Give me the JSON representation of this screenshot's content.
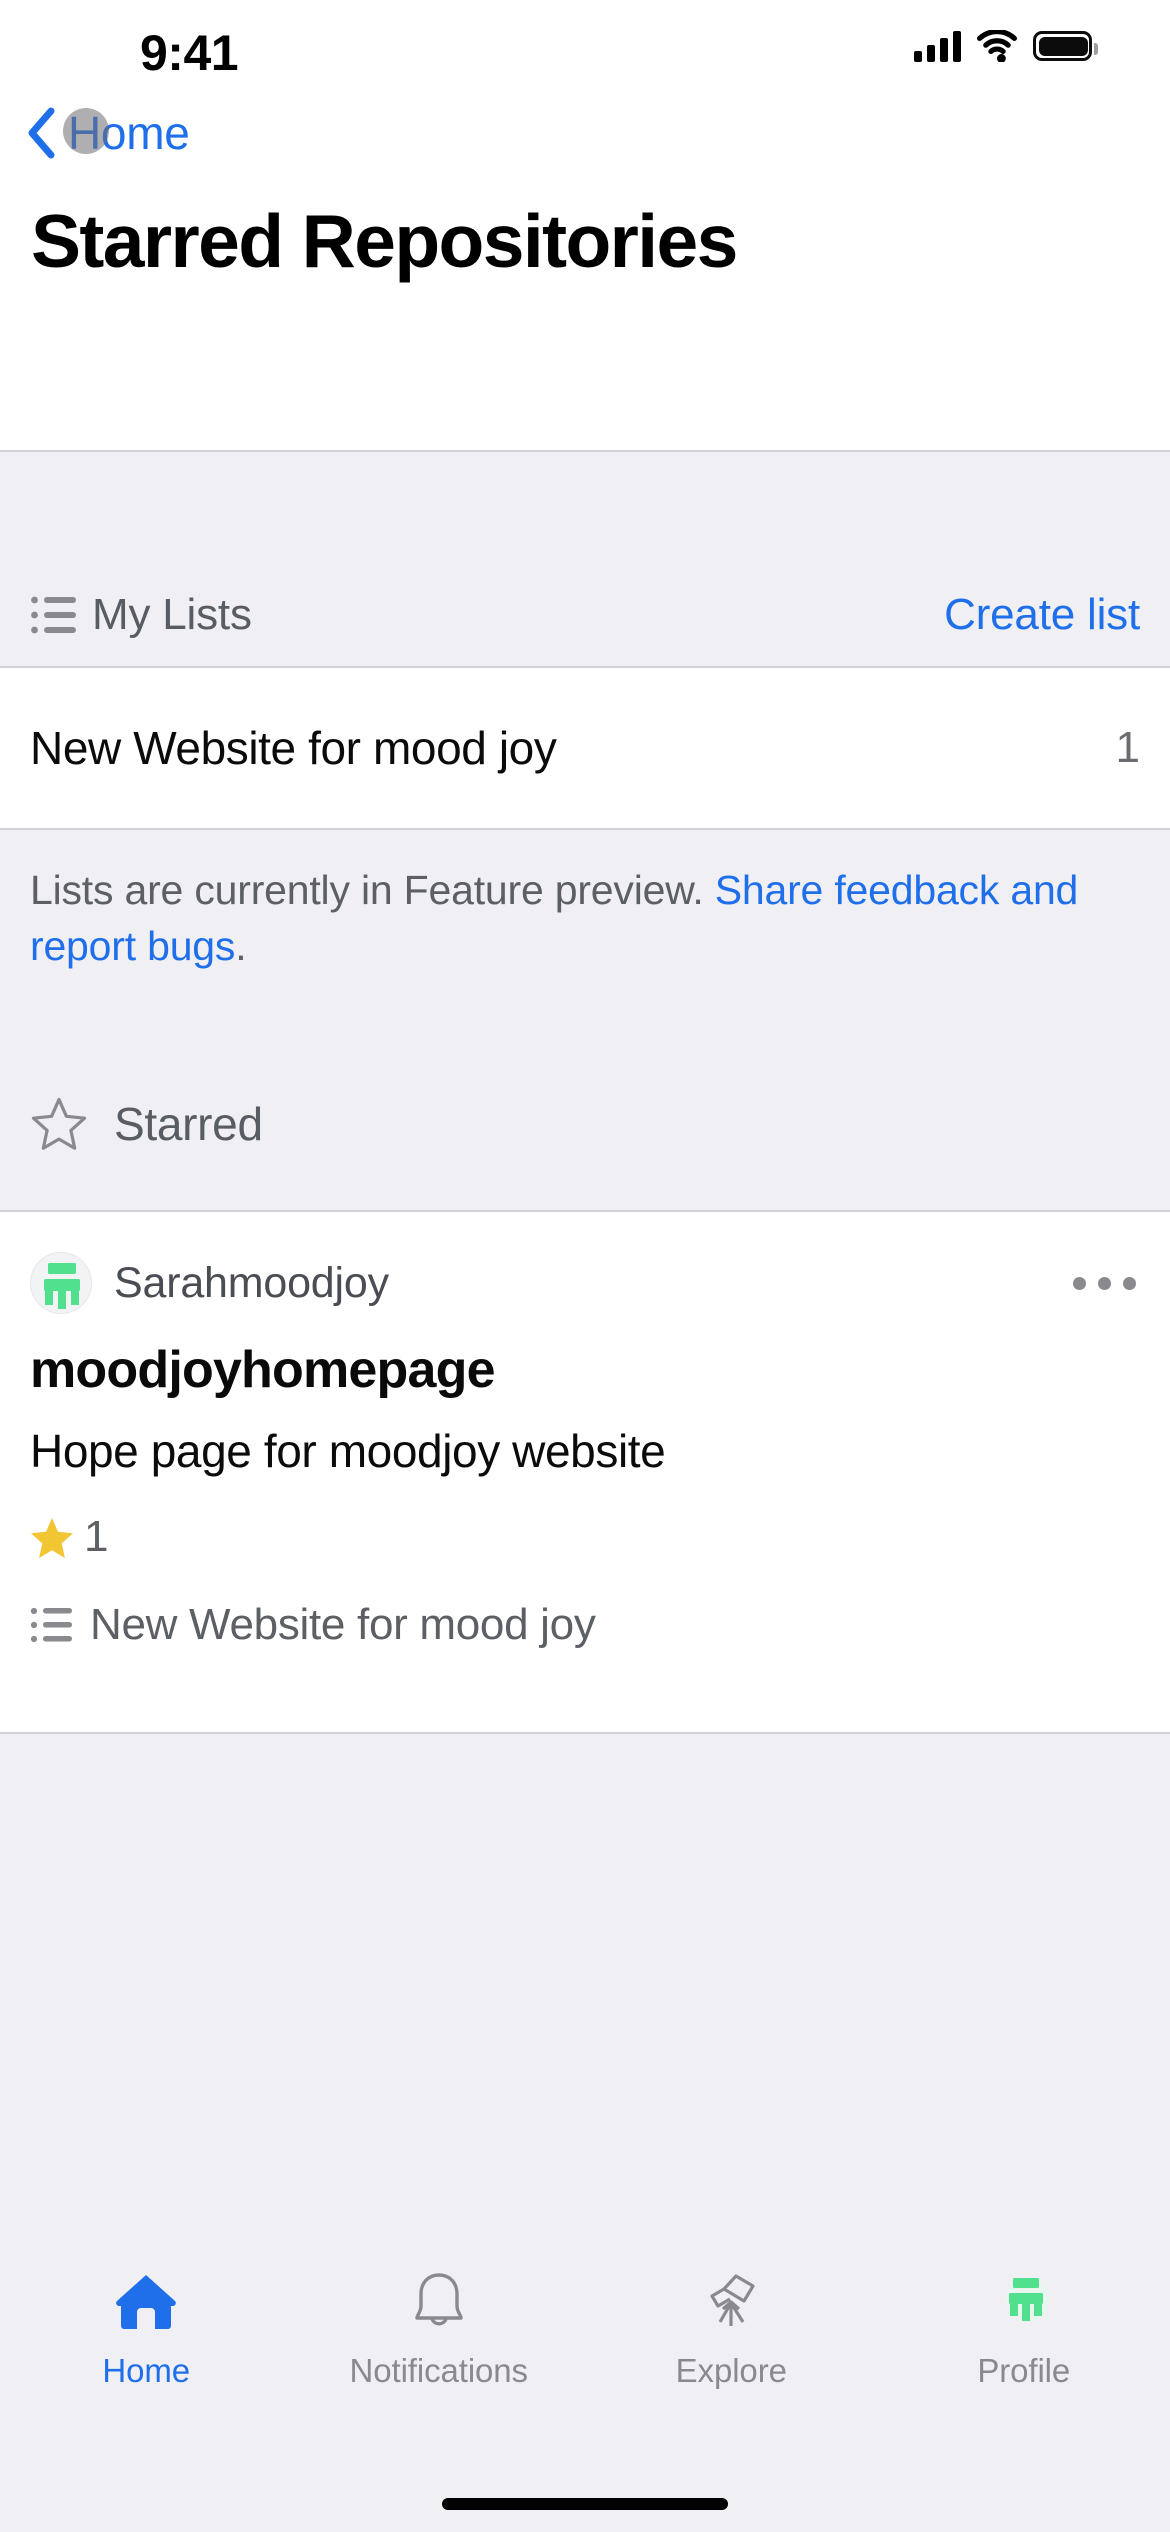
{
  "status_bar": {
    "time": "9:41",
    "signal_icon": "cellular-signal-icon",
    "wifi_icon": "wifi-icon",
    "battery_icon": "battery-full-icon"
  },
  "nav": {
    "back_icon": "chevron-left-icon",
    "back_label": "Home"
  },
  "header": {
    "title": "Starred Repositories"
  },
  "my_lists": {
    "icon": "unordered-list-icon",
    "label": "My Lists",
    "action_label": "Create list",
    "items": [
      {
        "name": "New Website for mood joy",
        "count": "1"
      }
    ]
  },
  "preview_note": {
    "text": "Lists are currently in Feature preview. ",
    "link_text": "Share feedback and report bugs",
    "trailing": "."
  },
  "starred_section": {
    "icon": "star-outline-icon",
    "label": "Starred"
  },
  "repositories": [
    {
      "avatar_icon": "moodjoy-avatar-icon",
      "owner": "Sarahmoodjoy",
      "menu_icon": "kebab-menu-icon",
      "name": "moodjoyhomepage",
      "description": "Hope page for moodjoy website",
      "star_icon": "star-filled-icon",
      "star_count": "1",
      "list_icon": "unordered-list-icon",
      "list_name": "New Website for mood joy"
    }
  ],
  "tab_bar": {
    "tabs": [
      {
        "icon": "home-icon",
        "label": "Home",
        "active": true
      },
      {
        "icon": "bell-icon",
        "label": "Notifications",
        "active": false
      },
      {
        "icon": "telescope-icon",
        "label": "Explore",
        "active": false
      },
      {
        "icon": "profile-avatar-icon",
        "label": "Profile",
        "active": false
      }
    ]
  },
  "colors": {
    "accent_blue": "#1F6FEB",
    "page_background": "#F0EFF4",
    "card_background": "#FFFFFF",
    "separator": "#D2D1D6",
    "secondary_text": "#5C6065",
    "brand_green": "#50E08E",
    "star_yellow": "#F2C533"
  }
}
